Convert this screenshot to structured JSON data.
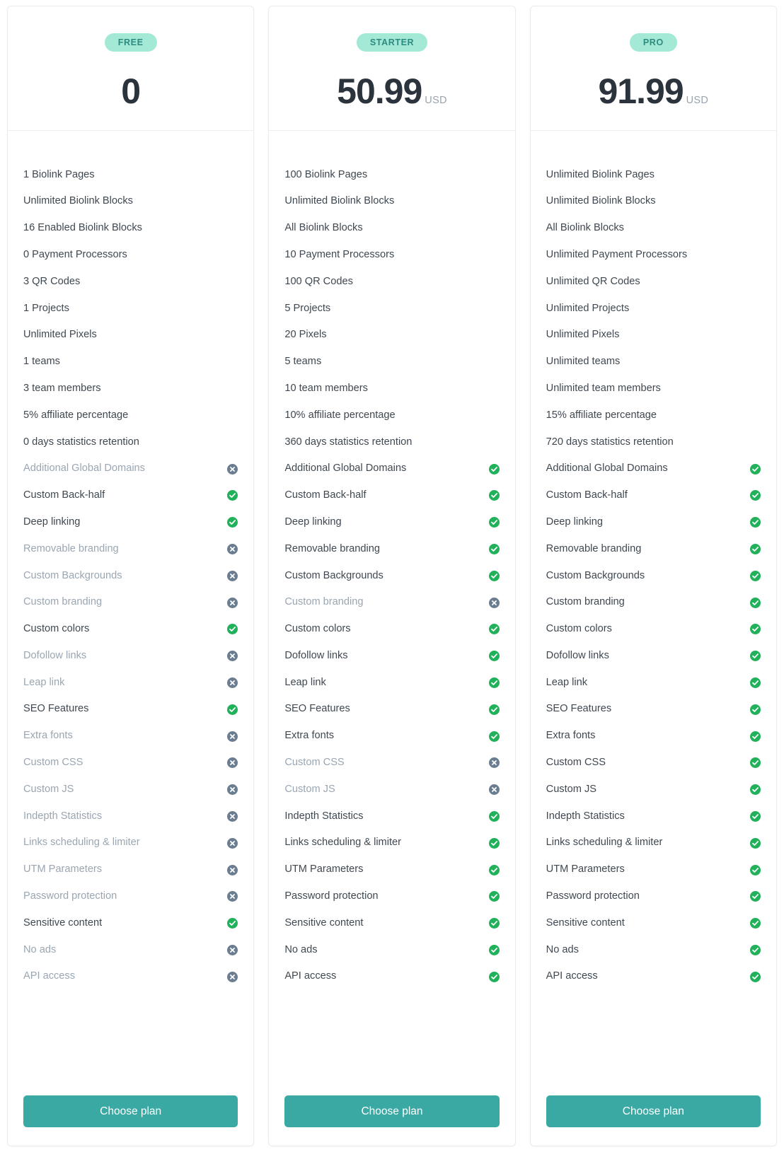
{
  "colors": {
    "badge_background": "#a3e9d5",
    "badge_text": "#2e8b80",
    "price_text": "#2b333c",
    "currency_text": "#9aa4ae",
    "feature_enabled_text": "#3f4851",
    "feature_disabled_text": "#9aa6b2",
    "check_icon": "#21b15a",
    "cross_icon": "#6b7d90",
    "button_background": "#3aa9a3",
    "button_text": "#ffffff",
    "card_border": "#e9ecef",
    "page_background": "#ffffff"
  },
  "icons": {
    "enabled": "check-circle-icon",
    "disabled": "cross-circle-icon"
  },
  "cta_label": "Choose plan",
  "plans": [
    {
      "badge": "FREE",
      "price": "0",
      "currency": "",
      "cta": "Choose plan",
      "quantitative_features": [
        "1 Biolink Pages",
        "Unlimited Biolink Blocks",
        "16 Enabled Biolink Blocks",
        "0 Payment Processors",
        "3 QR Codes",
        "1 Projects",
        "Unlimited Pixels",
        "1 teams",
        "3 team members",
        "5% affiliate percentage",
        "0 days statistics retention"
      ],
      "boolean_features": [
        {
          "label": "Additional Global Domains",
          "enabled": false
        },
        {
          "label": "Custom Back-half",
          "enabled": true
        },
        {
          "label": "Deep linking",
          "enabled": true
        },
        {
          "label": "Removable branding",
          "enabled": false
        },
        {
          "label": "Custom Backgrounds",
          "enabled": false
        },
        {
          "label": "Custom branding",
          "enabled": false
        },
        {
          "label": "Custom colors",
          "enabled": true
        },
        {
          "label": "Dofollow links",
          "enabled": false
        },
        {
          "label": "Leap link",
          "enabled": false
        },
        {
          "label": "SEO Features",
          "enabled": true
        },
        {
          "label": "Extra fonts",
          "enabled": false
        },
        {
          "label": "Custom CSS",
          "enabled": false
        },
        {
          "label": "Custom JS",
          "enabled": false
        },
        {
          "label": "Indepth Statistics",
          "enabled": false
        },
        {
          "label": "Links scheduling & limiter",
          "enabled": false
        },
        {
          "label": "UTM Parameters",
          "enabled": false
        },
        {
          "label": "Password protection",
          "enabled": false
        },
        {
          "label": "Sensitive content",
          "enabled": true
        },
        {
          "label": "No ads",
          "enabled": false
        },
        {
          "label": "API access",
          "enabled": false
        }
      ]
    },
    {
      "badge": "STARTER",
      "price": "50.99",
      "currency": "USD",
      "cta": "Choose plan",
      "quantitative_features": [
        "100 Biolink Pages",
        "Unlimited Biolink Blocks",
        "All Biolink Blocks",
        "10 Payment Processors",
        "100 QR Codes",
        "5 Projects",
        "20 Pixels",
        "5 teams",
        "10 team members",
        "10% affiliate percentage",
        "360 days statistics retention"
      ],
      "boolean_features": [
        {
          "label": "Additional Global Domains",
          "enabled": true
        },
        {
          "label": "Custom Back-half",
          "enabled": true
        },
        {
          "label": "Deep linking",
          "enabled": true
        },
        {
          "label": "Removable branding",
          "enabled": true
        },
        {
          "label": "Custom Backgrounds",
          "enabled": true
        },
        {
          "label": "Custom branding",
          "enabled": false
        },
        {
          "label": "Custom colors",
          "enabled": true
        },
        {
          "label": "Dofollow links",
          "enabled": true
        },
        {
          "label": "Leap link",
          "enabled": true
        },
        {
          "label": "SEO Features",
          "enabled": true
        },
        {
          "label": "Extra fonts",
          "enabled": true
        },
        {
          "label": "Custom CSS",
          "enabled": false
        },
        {
          "label": "Custom JS",
          "enabled": false
        },
        {
          "label": "Indepth Statistics",
          "enabled": true
        },
        {
          "label": "Links scheduling & limiter",
          "enabled": true
        },
        {
          "label": "UTM Parameters",
          "enabled": true
        },
        {
          "label": "Password protection",
          "enabled": true
        },
        {
          "label": "Sensitive content",
          "enabled": true
        },
        {
          "label": "No ads",
          "enabled": true
        },
        {
          "label": "API access",
          "enabled": true
        }
      ]
    },
    {
      "badge": "PRO",
      "price": "91.99",
      "currency": "USD",
      "cta": "Choose plan",
      "quantitative_features": [
        "Unlimited Biolink Pages",
        "Unlimited Biolink Blocks",
        "All Biolink Blocks",
        "Unlimited Payment Processors",
        "Unlimited QR Codes",
        "Unlimited Projects",
        "Unlimited Pixels",
        "Unlimited teams",
        "Unlimited team members",
        "15% affiliate percentage",
        "720 days statistics retention"
      ],
      "boolean_features": [
        {
          "label": "Additional Global Domains",
          "enabled": true
        },
        {
          "label": "Custom Back-half",
          "enabled": true
        },
        {
          "label": "Deep linking",
          "enabled": true
        },
        {
          "label": "Removable branding",
          "enabled": true
        },
        {
          "label": "Custom Backgrounds",
          "enabled": true
        },
        {
          "label": "Custom branding",
          "enabled": true
        },
        {
          "label": "Custom colors",
          "enabled": true
        },
        {
          "label": "Dofollow links",
          "enabled": true
        },
        {
          "label": "Leap link",
          "enabled": true
        },
        {
          "label": "SEO Features",
          "enabled": true
        },
        {
          "label": "Extra fonts",
          "enabled": true
        },
        {
          "label": "Custom CSS",
          "enabled": true
        },
        {
          "label": "Custom JS",
          "enabled": true
        },
        {
          "label": "Indepth Statistics",
          "enabled": true
        },
        {
          "label": "Links scheduling & limiter",
          "enabled": true
        },
        {
          "label": "UTM Parameters",
          "enabled": true
        },
        {
          "label": "Password protection",
          "enabled": true
        },
        {
          "label": "Sensitive content",
          "enabled": true
        },
        {
          "label": "No ads",
          "enabled": true
        },
        {
          "label": "API access",
          "enabled": true
        }
      ]
    }
  ]
}
